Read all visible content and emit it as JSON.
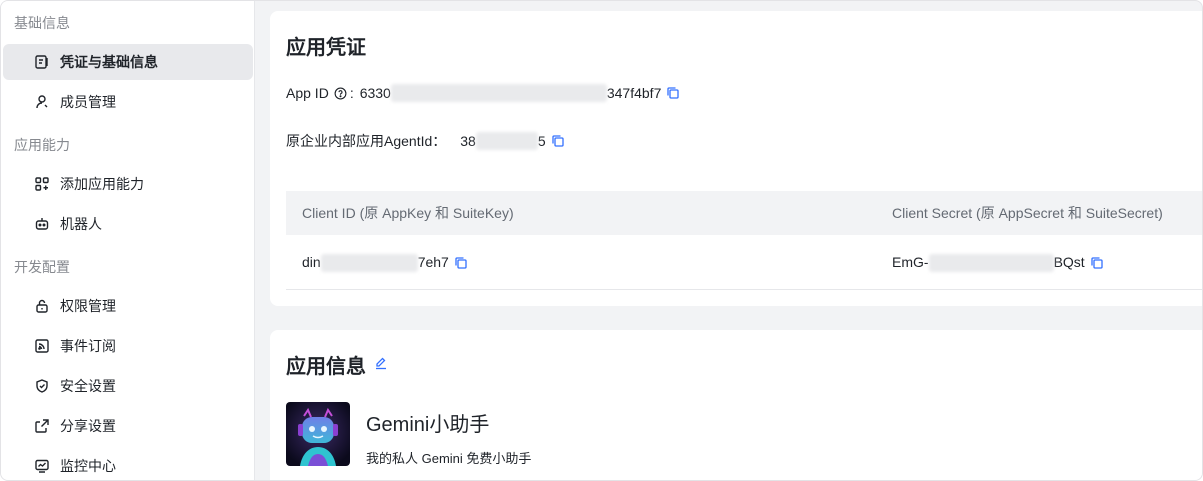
{
  "sidebar": {
    "groups": [
      {
        "title": "基础信息"
      },
      {
        "title": "应用能力"
      },
      {
        "title": "开发配置"
      }
    ],
    "items": [
      {
        "label": "凭证与基础信息",
        "icon": "credential-icon"
      },
      {
        "label": "成员管理",
        "icon": "user-icon"
      },
      {
        "label": "添加应用能力",
        "icon": "add-grid-icon"
      },
      {
        "label": "机器人",
        "icon": "robot-icon"
      },
      {
        "label": "权限管理",
        "icon": "lock-icon"
      },
      {
        "label": "事件订阅",
        "icon": "rss-icon"
      },
      {
        "label": "安全设置",
        "icon": "shield-icon"
      },
      {
        "label": "分享设置",
        "icon": "share-icon"
      },
      {
        "label": "监控中心",
        "icon": "monitor-icon"
      }
    ]
  },
  "credentials": {
    "title": "应用凭证",
    "app_id_label": "App ID",
    "app_id_colon": ":",
    "app_id_prefix": "6330",
    "app_id_suffix": "347f4bf7",
    "agent_label": "原企业内部应用AgentId：",
    "agent_prefix": "38",
    "agent_suffix": "5",
    "table": {
      "headers": [
        "Client ID (原 AppKey 和 SuiteKey)",
        "Client Secret (原 AppSecret 和 SuiteSecret)"
      ],
      "client_id_prefix": "din",
      "client_id_suffix": "7eh7",
      "client_secret_prefix": "EmG-",
      "client_secret_suffix": "BQst"
    }
  },
  "app_info": {
    "title": "应用信息",
    "name": "Gemini小助手",
    "description": "我的私人 Gemini 免费小助手"
  },
  "colors": {
    "accent": "#3370ff",
    "sidebar_active": "#e8e9ec",
    "page_bg": "#f2f3f5"
  }
}
